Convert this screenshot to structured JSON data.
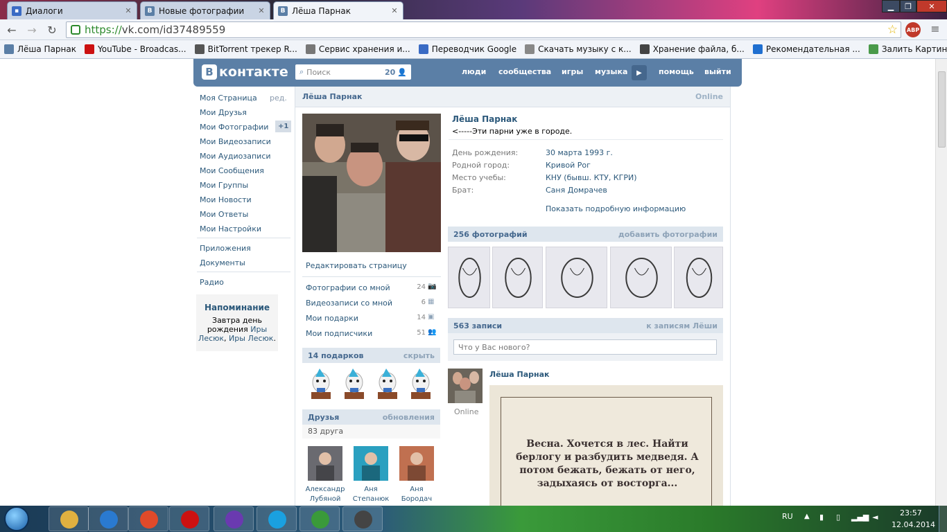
{
  "browser": {
    "tabs": [
      {
        "label": "Диалоги",
        "icon": "chat-icon",
        "active": false
      },
      {
        "label": "Новые фотографии",
        "icon": "vk-icon",
        "active": false
      },
      {
        "label": "Лёша Парнак",
        "icon": "vk-icon",
        "active": true
      }
    ],
    "url_https": "https://",
    "url_rest": "vk.com/id37489559",
    "bookmarks": [
      {
        "label": "Лёша Парнак",
        "color": "#5b7fa6"
      },
      {
        "label": "YouTube - Broadcas...",
        "color": "#cc1111"
      },
      {
        "label": "BitTorrent трекер R...",
        "color": "#555555"
      },
      {
        "label": "Сервис хранения и...",
        "color": "#777777"
      },
      {
        "label": "Переводчик Google",
        "color": "#3a6bc4"
      },
      {
        "label": "Скачать музыку с к...",
        "color": "#888888"
      },
      {
        "label": "Хранение файла, б...",
        "color": "#444444"
      },
      {
        "label": "Рекомендательная ...",
        "color": "#1f6fd0"
      },
      {
        "label": "Залить Картинку - ...",
        "color": "#4a9a4a"
      }
    ]
  },
  "vk": {
    "logo": "контакте",
    "search_placeholder": "Поиск",
    "search_count": "20",
    "nav": [
      "люди",
      "сообщества",
      "игры",
      "музыка",
      "помощь",
      "выйти"
    ],
    "left_menu": [
      {
        "label": "Моя Страница",
        "extra": "ред."
      },
      {
        "label": "Мои Друзья"
      },
      {
        "label": "Мои Фотографии",
        "badge": "+1"
      },
      {
        "label": "Мои Видеозаписи"
      },
      {
        "label": "Мои Аудиозаписи"
      },
      {
        "label": "Мои Сообщения"
      },
      {
        "label": "Мои Группы"
      },
      {
        "label": "Мои Новости"
      },
      {
        "label": "Мои Ответы"
      },
      {
        "label": "Мои Настройки"
      }
    ],
    "left_menu2": [
      "Приложения",
      "Документы"
    ],
    "left_menu3": [
      "Радио"
    ],
    "reminder": {
      "title": "Напоминание",
      "text1": "Завтра ",
      "text2": "день рождения",
      "name1": "Иры Лесюк",
      "sep": ", ",
      "name2": "Иры Лесюк",
      "end": "."
    },
    "profile": {
      "header_name": "Лёша Парнак",
      "online": "Online",
      "name": "Лёша Парнак",
      "status": "<-----Эти парни уже в городе.",
      "info": [
        {
          "label": "День рождения:",
          "value": "30 марта 1993 г."
        },
        {
          "label": "Родной город:",
          "value": "Кривой Рог"
        },
        {
          "label": "Место учебы:",
          "value": "КНУ (бывш. КТУ, КГРИ)"
        },
        {
          "label": "Брат:",
          "value": "Саня Домрачев"
        }
      ],
      "show_more": "Показать подробную информацию",
      "edit": "Редактировать страницу",
      "counters": [
        {
          "label": "Фотографии со мной",
          "count": "24",
          "icon": "camera-icon"
        },
        {
          "label": "Видеозаписи со мной",
          "count": "6",
          "icon": "film-icon"
        },
        {
          "label": "Мои подарки",
          "count": "14",
          "icon": "gift-icon"
        },
        {
          "label": "Мои подписчики",
          "count": "51",
          "icon": "people-icon"
        }
      ],
      "gifts_title": "14 подарков",
      "gifts_hide": "скрыть",
      "friends_title": "Друзья",
      "friends_updates": "обновления",
      "friends_count": "83 друга",
      "friends": [
        {
          "first": "Александр",
          "last": "Лубяной"
        },
        {
          "first": "Аня",
          "last": "Степанюк"
        },
        {
          "first": "Аня",
          "last": "Бородач"
        }
      ],
      "photos_title": "256 фотографий",
      "photos_add": "добавить фотографии",
      "wall_title": "563 записи",
      "wall_link": "к записям Лёши",
      "wall_placeholder": "Что у Вас нового?",
      "post_author": "Лёша Парнак",
      "post_online": "Online",
      "post_text": "Весна. Хочется в лес. Найти берлогу и разбудить медведя. А потом бежать, бежать от него, задыхаясь от восторга..."
    }
  },
  "taskbar": {
    "lang": "RU",
    "time": "23:57",
    "date": "12.04.2014",
    "apps": [
      "folder-icon",
      "media-player-icon",
      "chrome-icon",
      "opera-icon",
      "visual-studio-icon",
      "skype-icon",
      "utorrent-icon",
      "game-icon"
    ]
  }
}
